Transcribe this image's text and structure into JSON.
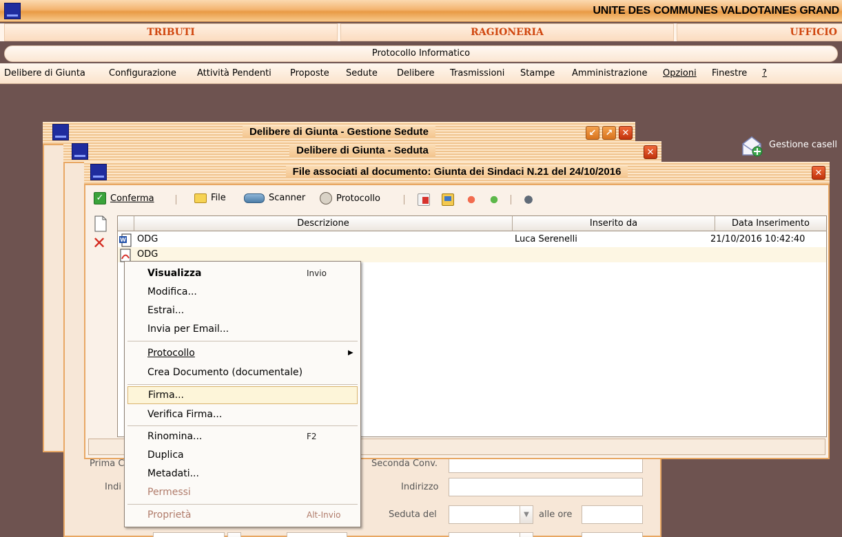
{
  "app": {
    "title": "UNITE DES COMMUNES VALDOTAINES GRAND",
    "subtitle": "Protocollo Informatico"
  },
  "modules": [
    "TRIBUTI",
    "RAGIONERIA",
    "UFFICIO"
  ],
  "menubar": [
    "Delibere di Giunta",
    "Configurazione",
    "Attività Pendenti",
    "Proposte",
    "Sedute",
    "Delibere",
    "Trasmissioni",
    "Stampe",
    "Amministrazione",
    "Opzioni",
    "Finestre",
    "?"
  ],
  "desktop": {
    "shortcut_label": "Gestione casell"
  },
  "windows": {
    "sedute": {
      "title": "Delibere di Giunta - Gestione Sedute"
    },
    "seduta": {
      "title": "Delibere di Giunta - Seduta",
      "labels": {
        "prima_conv": "Prima C",
        "seconda_conv": "Seconda Conv.",
        "indirizzo_left": "Indi",
        "indirizzo": "Indirizzo",
        "seduta_del": "Seduta del",
        "alle_ore": "alle ore"
      }
    }
  },
  "files_dialog": {
    "title": "File associati al documento: Giunta dei Sindaci N.21 del 24/10/2016",
    "toolbar": {
      "confirm": "Conferma",
      "file": "File",
      "scanner": "Scanner",
      "protocol": "Protocollo"
    },
    "columns": [
      "Descrizione",
      "Inserito da",
      "Data Inserimento"
    ],
    "rows": [
      {
        "icon": "word-doc-icon",
        "descrizione": "ODG",
        "inserito_da": "Luca Serenelli",
        "data": "21/10/2016 10:42:40"
      },
      {
        "icon": "pdf-icon",
        "descrizione": "ODG",
        "inserito_da": "",
        "data": ""
      }
    ]
  },
  "context_menu": {
    "items": [
      {
        "label": "Visualizza",
        "shortcut": "Invio"
      },
      {
        "label": "Modifica..."
      },
      {
        "label": "Estrai..."
      },
      {
        "label": "Invia per Email..."
      },
      {
        "label": "Protocollo"
      },
      {
        "label": "Crea Documento (documentale)"
      },
      {
        "label": "Firma..."
      },
      {
        "label": "Verifica Firma..."
      },
      {
        "label": "Rinomina...",
        "shortcut": "F2"
      },
      {
        "label": "Duplica"
      },
      {
        "label": "Metadati..."
      },
      {
        "label": "Permessi"
      },
      {
        "label": "Proprietà",
        "shortcut": "Alt-Invio"
      }
    ]
  },
  "colors": {
    "accent": "#e8a763",
    "close_button": "#d9401a",
    "desktop": "#6e5350",
    "module_text": "#d0460e"
  }
}
